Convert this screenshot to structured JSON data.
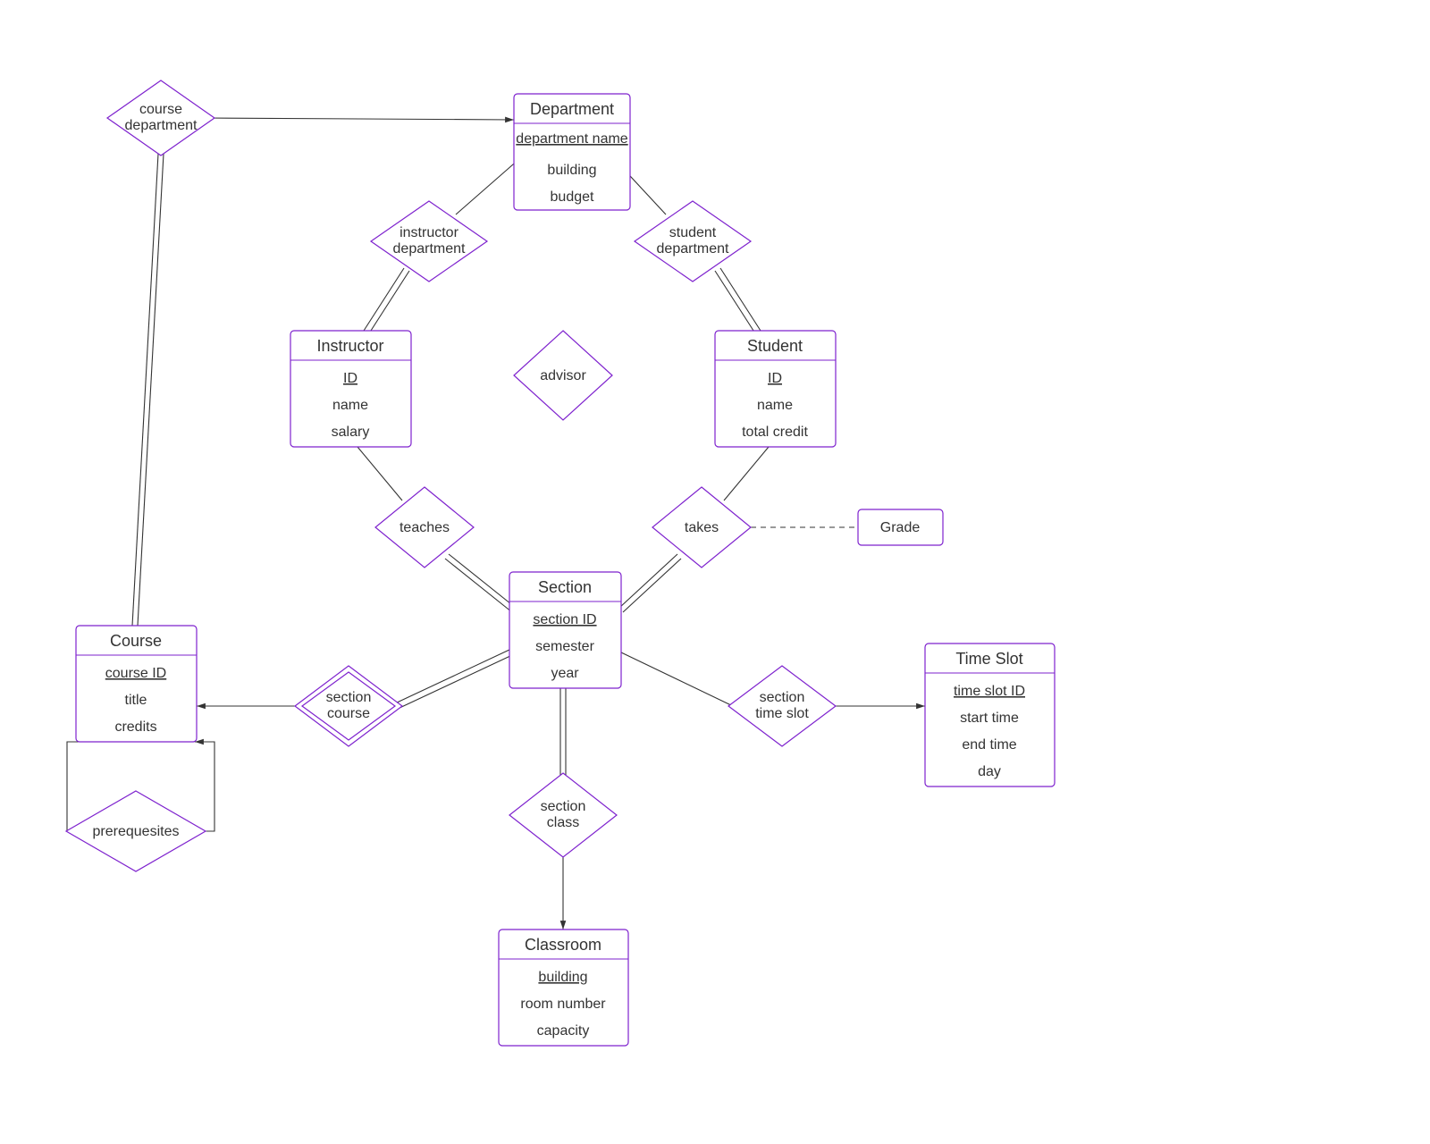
{
  "entities": {
    "department": {
      "title": "Department",
      "attrs": [
        "department name",
        "building",
        "budget"
      ],
      "key": 0
    },
    "instructor": {
      "title": "Instructor",
      "attrs": [
        "ID",
        "name",
        "salary"
      ],
      "key": 0
    },
    "student": {
      "title": "Student",
      "attrs": [
        "ID",
        "name",
        "total credit"
      ],
      "key": 0
    },
    "course": {
      "title": "Course",
      "attrs": [
        "course ID",
        "title",
        "credits"
      ],
      "key": 0
    },
    "section": {
      "title": "Section",
      "attrs": [
        "section ID",
        "semester",
        "year"
      ],
      "key": 0
    },
    "classroom": {
      "title": "Classroom",
      "attrs": [
        "building",
        "room number",
        "capacity"
      ],
      "key": 0
    },
    "timeslot": {
      "title": "Time Slot",
      "attrs": [
        "time slot ID",
        "start time",
        "end time",
        "day"
      ],
      "key": 0
    }
  },
  "relationships": {
    "course_dept": "course department",
    "instr_dept": "instructor department",
    "stud_dept": "student department",
    "advisor": "advisor",
    "teaches": "teaches",
    "takes": "takes",
    "section_course": "section course",
    "section_class": "section class",
    "section_timeslot": "section time slot",
    "prereq": "prerequesites"
  },
  "extra": {
    "grade": "Grade"
  }
}
